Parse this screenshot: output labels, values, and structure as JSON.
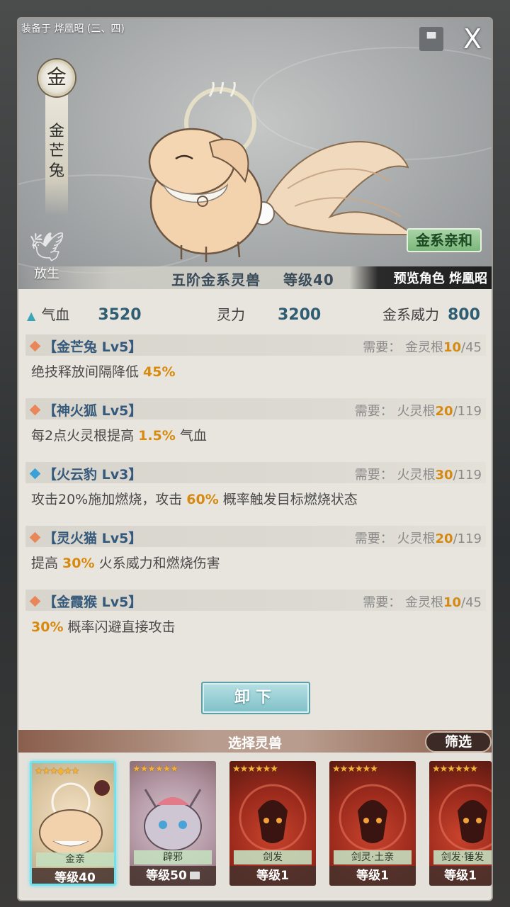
{
  "header": {
    "equipped_on": "装备于 烨凰昭 (三、四)",
    "close_label": "X"
  },
  "beast": {
    "element_char": "金",
    "name": "金芒兔",
    "release_label": "放生",
    "affinity_label": "金系亲和",
    "rank_text": "五阶金系灵兽",
    "level_text": "等级40",
    "preview_text": "预览角色 烨凰昭"
  },
  "stats": [
    {
      "label": "气血",
      "value": "3520"
    },
    {
      "label": "灵力",
      "value": "3200"
    },
    {
      "label": "金系威力",
      "value": "800"
    }
  ],
  "skills": [
    {
      "diamond": "orange",
      "title": "【金芒兔 Lv5】",
      "req_prefix": "需要： 金灵根",
      "req_cur": "10",
      "req_max": "/45",
      "desc_pre": "绝技释放间隔降低 ",
      "desc_hl": "45%",
      "desc_post": ""
    },
    {
      "diamond": "orange",
      "title": "【神火狐 Lv5】",
      "req_prefix": "需要： 火灵根",
      "req_cur": "20",
      "req_max": "/119",
      "desc_pre": "每2点火灵根提高 ",
      "desc_hl": "1.5%",
      "desc_post": " 气血"
    },
    {
      "diamond": "blue",
      "title": "【火云豹 Lv3】",
      "req_prefix": "需要： 火灵根",
      "req_cur": "30",
      "req_max": "/119",
      "desc_pre": "攻击20%施加燃烧，攻击 ",
      "desc_hl": "60%",
      "desc_post": " 概率触发目标燃烧状态"
    },
    {
      "diamond": "orange",
      "title": "【灵火猫 Lv5】",
      "req_prefix": "需要： 火灵根",
      "req_cur": "20",
      "req_max": "/119",
      "desc_pre": "提高 ",
      "desc_hl": "30%",
      "desc_post": " 火系威力和燃烧伤害"
    },
    {
      "diamond": "orange",
      "title": "【金霞猴 Lv5】",
      "req_prefix": "需要： 金灵根",
      "req_cur": "10",
      "req_max": "/45",
      "desc_pre": "",
      "desc_hl": "30%",
      "desc_post": " 概率闪避直接攻击"
    }
  ],
  "unequip_label": "卸下",
  "selection": {
    "title": "选择灵兽",
    "filter_label": "筛选",
    "cards": [
      {
        "tag": "金亲",
        "level": "等级40",
        "selected": true,
        "portrait": "rabbit",
        "stars": "★★★◆★★"
      },
      {
        "tag": "辟邪",
        "level": "等级50",
        "selected": false,
        "portrait": "cat",
        "stars": "★★★★★★"
      },
      {
        "tag": "剑发",
        "level": "等级1",
        "selected": false,
        "portrait": "demon",
        "stars": "★★★★★★"
      },
      {
        "tag": "剑灵·土亲",
        "level": "等级1",
        "selected": false,
        "portrait": "demon",
        "stars": "★★★★★★"
      },
      {
        "tag": "剑发·锤发",
        "level": "等级1",
        "selected": false,
        "portrait": "demon",
        "stars": "★★★★★★"
      }
    ]
  },
  "colors": {
    "highlight": "#d88a10",
    "title_blue": "#34597a",
    "affinity_green": "#7cb77b",
    "selected_border": "#6fe2f0"
  }
}
